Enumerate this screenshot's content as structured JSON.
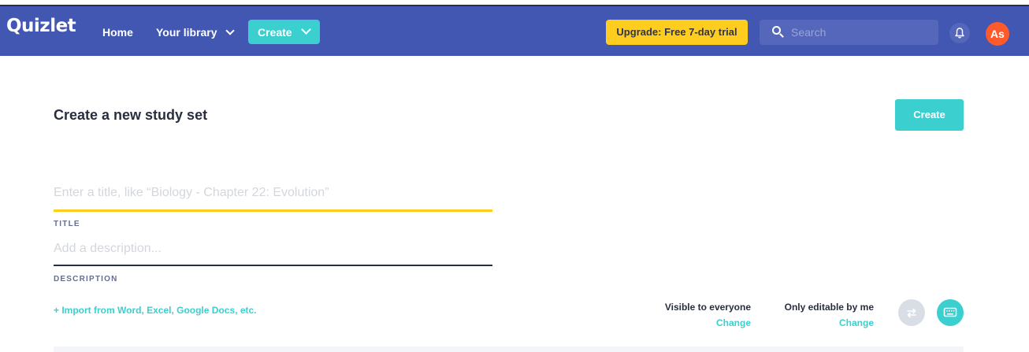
{
  "nav": {
    "logo": "Quizlet",
    "home": "Home",
    "library": "Your library",
    "create": "Create",
    "upgrade": "Upgrade: Free 7-day trial",
    "search_placeholder": "Search",
    "avatar_initials": "As"
  },
  "main": {
    "page_title": "Create a new study set",
    "create_button": "Create",
    "title_placeholder": "Enter a title, like “Biology - Chapter 22: Evolution”",
    "title_label": "TITLE",
    "description_placeholder": "Add a description...",
    "description_label": "DESCRIPTION",
    "import_link": "+ Import from Word, Excel, Google Docs, etc.",
    "visibility": {
      "label": "Visible to everyone",
      "change": "Change"
    },
    "editability": {
      "label": "Only editable by me",
      "change": "Change"
    }
  },
  "icons": {
    "chevron": "chevron-down-icon",
    "search": "search-icon",
    "bell": "bell-icon",
    "swap": "swap-icon",
    "keyboard": "keyboard-icon"
  },
  "colors": {
    "brand": "#4257b2",
    "accent": "#3ccfcf",
    "upgrade": "#ffcd1f",
    "avatar": "#ff5a2b"
  }
}
